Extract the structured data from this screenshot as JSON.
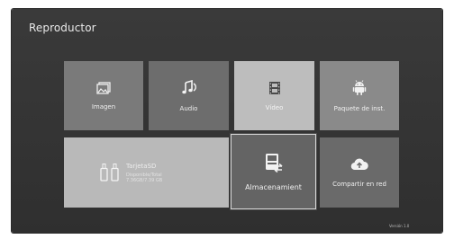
{
  "app": {
    "title": "Reproductor"
  },
  "tiles": {
    "imagen": {
      "label": "Imagen",
      "icon": "image-icon"
    },
    "audio": {
      "label": "Audio",
      "icon": "music-note-icon"
    },
    "video": {
      "label": "Vídeo",
      "icon": "film-icon"
    },
    "paquete": {
      "label": "Paquete de inst.",
      "icon": "android-icon"
    },
    "tarjeta": {
      "label": "TarjetaSD",
      "detail_line1": "Disponible/Total",
      "detail_line2": "7.36GB/7.39 GB",
      "icon": "sd-card-icon"
    },
    "almacenamiento": {
      "label": "Almacenamient",
      "icon": "storage-icon"
    },
    "compartir": {
      "label": "Compartir en red",
      "icon": "cloud-upload-icon"
    }
  },
  "footer": {
    "version": "Versión 1.0"
  },
  "colors": {
    "background": "#333333",
    "tile_selected_border": "#d8d8d8"
  }
}
